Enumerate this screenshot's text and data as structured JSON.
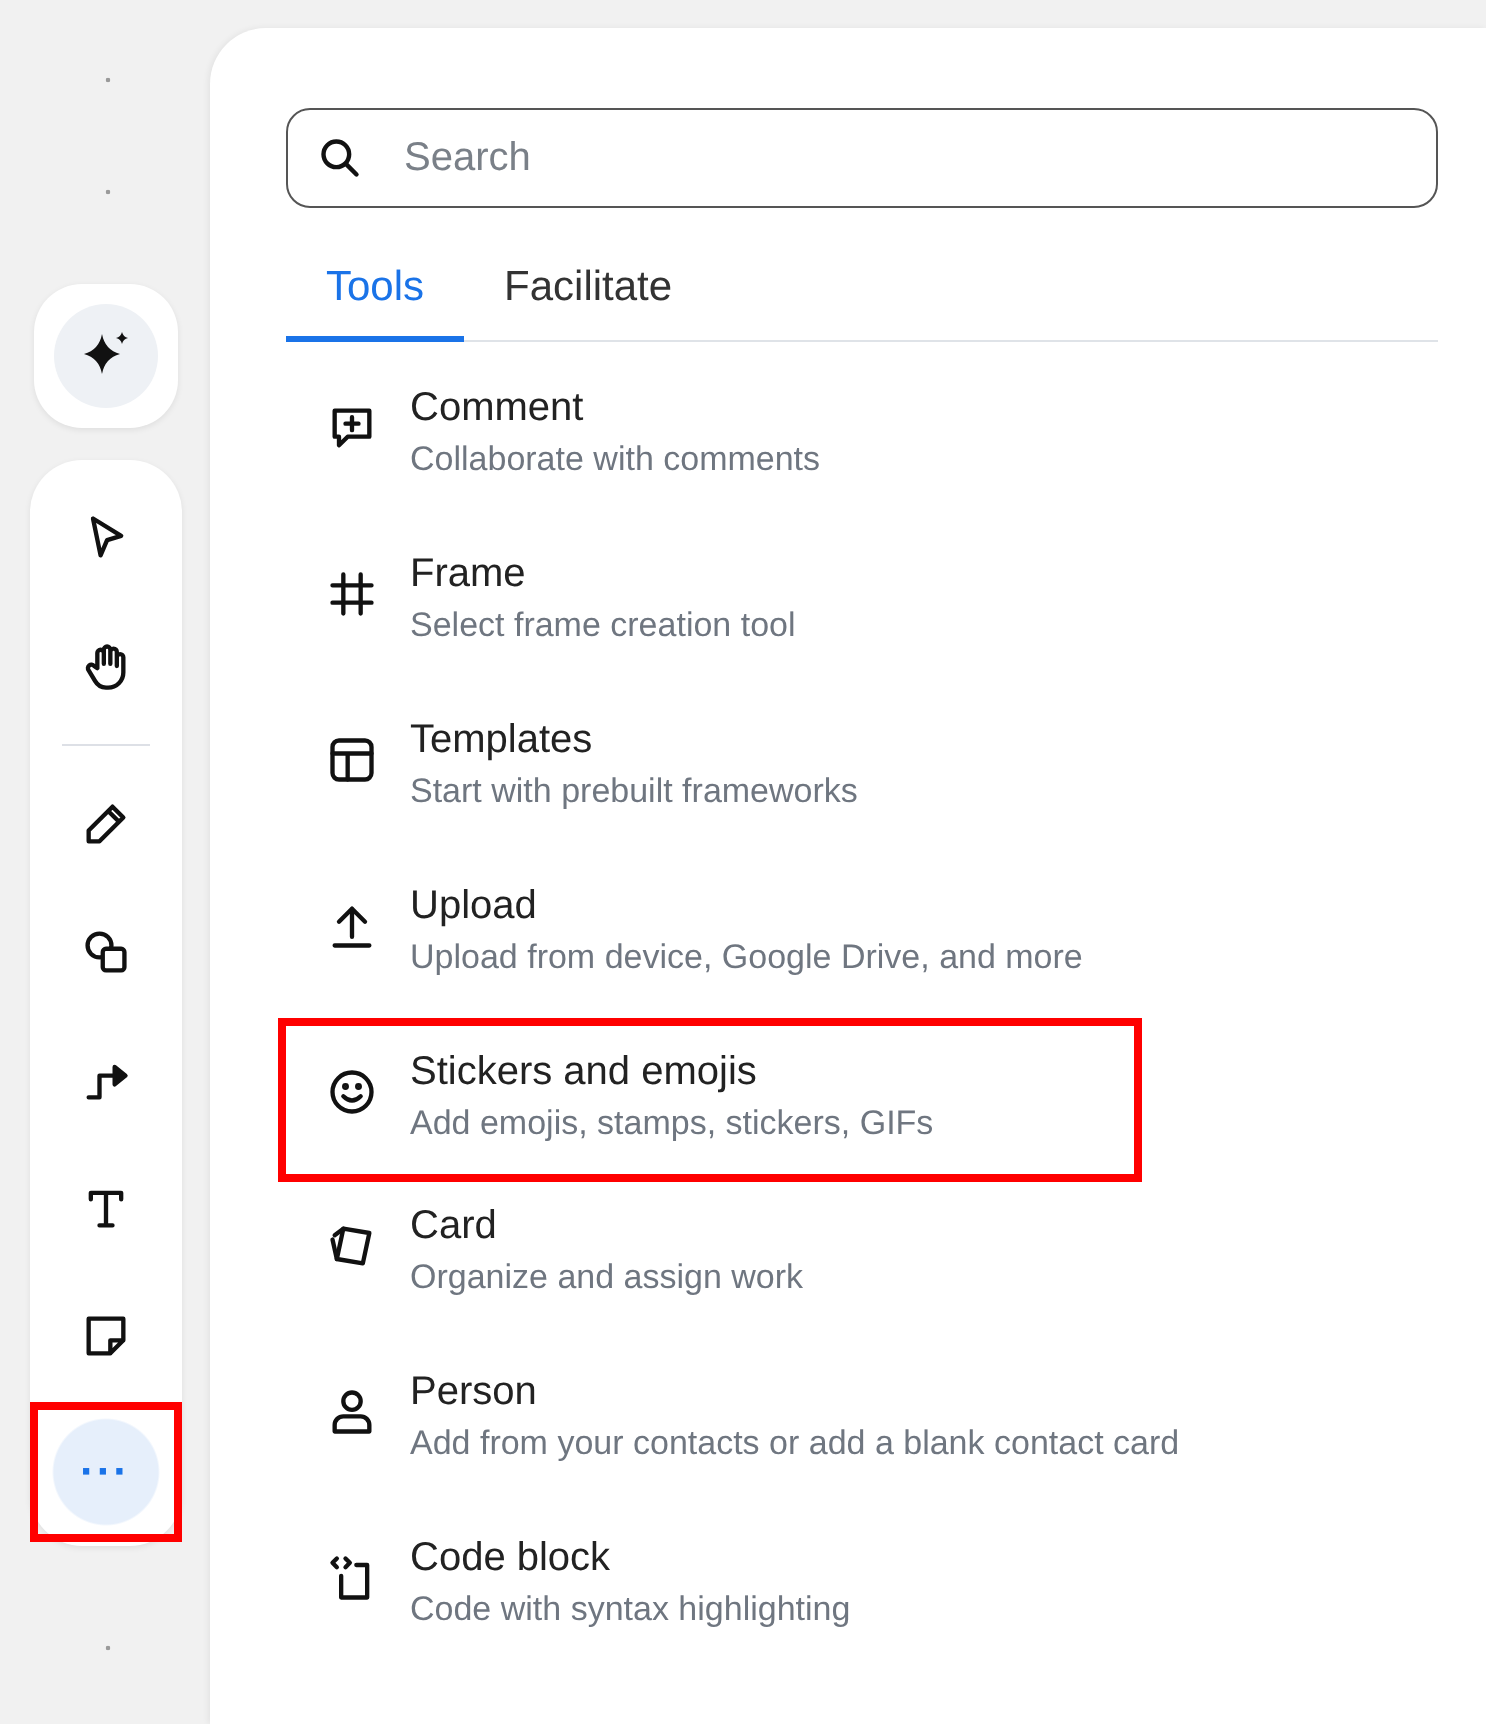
{
  "toolbar": {
    "assistant": {
      "selected": false
    },
    "items": [
      {
        "kind": "tool",
        "selected": false,
        "highlighted": false
      },
      {
        "kind": "tool",
        "selected": false,
        "highlighted": false
      },
      {
        "kind": "divider"
      },
      {
        "kind": "tool",
        "selected": false,
        "highlighted": false
      },
      {
        "kind": "tool",
        "selected": false,
        "highlighted": false
      },
      {
        "kind": "tool",
        "selected": false,
        "highlighted": false
      },
      {
        "kind": "tool",
        "selected": false,
        "highlighted": false
      },
      {
        "kind": "tool",
        "selected": false,
        "highlighted": false
      },
      {
        "kind": "more",
        "label": "···",
        "selected": true,
        "highlighted": true
      }
    ]
  },
  "panel": {
    "search": {
      "placeholder": "Search"
    },
    "tabs": [
      {
        "label": "Tools",
        "selected": true
      },
      {
        "label": "Facilitate",
        "selected": false
      }
    ],
    "tools": [
      {
        "title": "Comment",
        "description": "Collaborate with comments",
        "highlighted": false
      },
      {
        "title": "Frame",
        "description": "Select frame creation tool",
        "highlighted": false
      },
      {
        "title": "Templates",
        "description": "Start with prebuilt frameworks",
        "highlighted": false
      },
      {
        "title": "Upload",
        "description": "Upload from device, Google Drive, and more",
        "highlighted": false
      },
      {
        "title": "Stickers and emojis",
        "description": "Add emojis, stamps, stickers, GIFs",
        "highlighted": true
      },
      {
        "title": "Card",
        "description": "Organize and assign work",
        "highlighted": false
      },
      {
        "title": "Person",
        "description": "Add from your contacts or add a blank contact card",
        "highlighted": false
      },
      {
        "title": "Code block",
        "description": "Code with syntax highlighting",
        "highlighted": false
      }
    ]
  }
}
